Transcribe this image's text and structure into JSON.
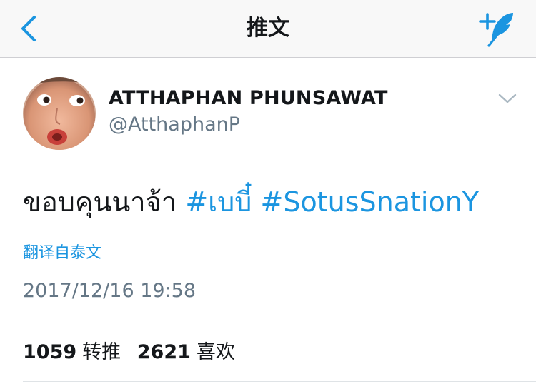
{
  "nav": {
    "title": "推文",
    "accent_color": "#1b95e0",
    "back_icon": "chevron-left-icon",
    "compose_icon": "compose-tweet-icon"
  },
  "tweet": {
    "display_name": "ATTHAPHAN PHUNSAWAT",
    "username": "@AtthaphanP",
    "text": "ขอบคุนนาจ้า",
    "hashtags": [
      "#เบบี๋",
      "#SotusSnationY"
    ],
    "translate_label": "翻译自泰文",
    "timestamp": "2017/12/16 19:58",
    "more_icon": "chevron-down-icon"
  },
  "stats": {
    "retweets_count": "1059",
    "retweets_label": "转推",
    "likes_count": "2621",
    "likes_label": "喜欢"
  }
}
